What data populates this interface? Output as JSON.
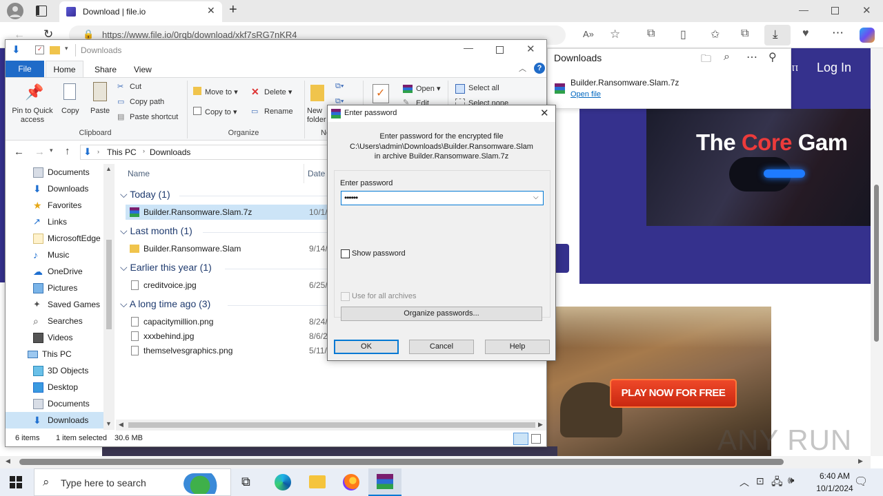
{
  "browser": {
    "tab_title": "Download | file.io",
    "url": "https://www.file.io/0rqb/download/xkf7sRG7nKR4",
    "downloads_panel": {
      "title": "Downloads",
      "file_name": "Builder.Ransomware.Slam.7z",
      "open_link": "Open file"
    }
  },
  "page": {
    "login": "Log In",
    "hero_text_1": "The",
    "hero_text_2": "Core",
    "hero_text_3": "Gam",
    "play_button": "PLAY NOW FOR FREE",
    "watermark": "ANY RUN"
  },
  "explorer": {
    "title": "Downloads",
    "tabs": [
      "File",
      "Home",
      "Share",
      "View"
    ],
    "ribbon": {
      "pin": "Pin to Quick access",
      "copy": "Copy",
      "paste": "Paste",
      "cut": "Cut",
      "copy_path": "Copy path",
      "paste_shortcut": "Paste shortcut",
      "clipboard": "Clipboard",
      "move_to": "Move to",
      "copy_to": "Copy to",
      "delete": "Delete",
      "rename": "Rename",
      "organize": "Organize",
      "new_folder": "New folder",
      "new_group": "Ne",
      "open": "Open",
      "edit": "Edit",
      "select_all": "Select all",
      "select_none": "Select none"
    },
    "breadcrumb": [
      "This PC",
      "Downloads"
    ],
    "nav": [
      {
        "label": "Documents",
        "icon": "documents-icon"
      },
      {
        "label": "Downloads",
        "icon": "downloads-icon"
      },
      {
        "label": "Favorites",
        "icon": "star-icon"
      },
      {
        "label": "Links",
        "icon": "links-icon"
      },
      {
        "label": "MicrosoftEdge",
        "icon": "folder-icon"
      },
      {
        "label": "Music",
        "icon": "music-icon"
      },
      {
        "label": "OneDrive",
        "icon": "cloud-icon"
      },
      {
        "label": "Pictures",
        "icon": "pictures-icon"
      },
      {
        "label": "Saved Games",
        "icon": "games-icon"
      },
      {
        "label": "Searches",
        "icon": "search-icon"
      },
      {
        "label": "Videos",
        "icon": "videos-icon"
      },
      {
        "label": "This PC",
        "icon": "pc-icon"
      },
      {
        "label": "3D Objects",
        "icon": "cube-icon"
      },
      {
        "label": "Desktop",
        "icon": "desktop-icon"
      },
      {
        "label": "Documents",
        "icon": "documents-icon"
      },
      {
        "label": "Downloads",
        "icon": "downloads-icon"
      }
    ],
    "columns": {
      "name": "Name",
      "date": "Date"
    },
    "groups": [
      {
        "header": "Today (1)",
        "files": [
          {
            "name": "Builder.Ransomware.Slam.7z",
            "date": "10/1/",
            "icon": "archive"
          }
        ]
      },
      {
        "header": "Last month (1)",
        "files": [
          {
            "name": "Builder.Ransomware.Slam",
            "date": "9/14/",
            "icon": "folder"
          }
        ]
      },
      {
        "header": "Earlier this year (1)",
        "files": [
          {
            "name": "creditvoice.jpg",
            "date": "6/25/",
            "icon": "image"
          }
        ]
      },
      {
        "header": "A long time ago (3)",
        "files": [
          {
            "name": "capacitymillion.png",
            "date": "8/24/",
            "icon": "image"
          },
          {
            "name": "xxxbehind.jpg",
            "date": "8/6/2",
            "icon": "image"
          },
          {
            "name": "themselvesgraphics.png",
            "date": "5/11/",
            "icon": "image"
          }
        ]
      }
    ],
    "status": {
      "items": "6 items",
      "selected": "1 item selected",
      "size": "30.6 MB"
    }
  },
  "dialog": {
    "title": "Enter password",
    "message_1": "Enter password for the encrypted file",
    "message_2": "C:\\Users\\admin\\Downloads\\Builder.Ransomware.Slam",
    "message_3": "in archive Builder.Ransomware.Slam.7z",
    "label": "Enter password",
    "password_mask": "••••••",
    "show_password": "Show password",
    "use_for_all": "Use for all archives",
    "organize": "Organize passwords...",
    "ok": "OK",
    "cancel": "Cancel",
    "help": "Help"
  },
  "taskbar": {
    "search_placeholder": "Type here to search",
    "time": "6:40 AM",
    "date": "10/1/2024"
  },
  "colors": {
    "accent": "#0078d4",
    "page_purple": "#35318d",
    "play_red": "#e0381c"
  }
}
